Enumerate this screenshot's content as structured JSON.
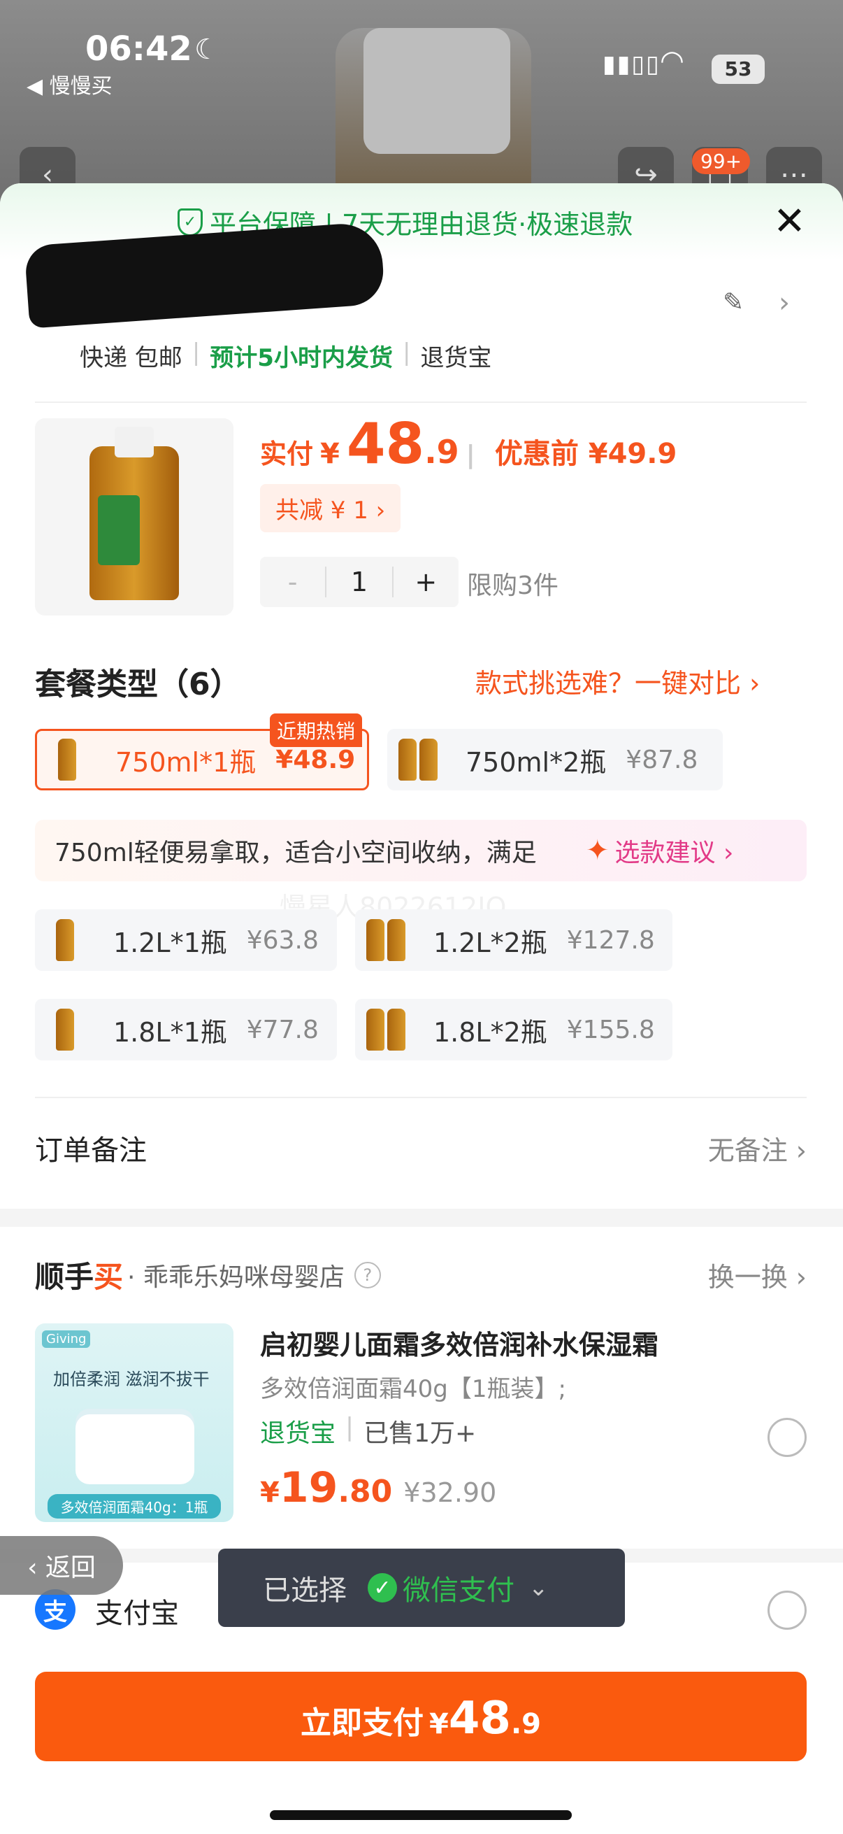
{
  "status_bar": {
    "time": "06:42",
    "back_app": "◀ 慢慢买",
    "battery": "53"
  },
  "background": {
    "cart_badge": "99+"
  },
  "guarantee": {
    "text": "平台保障 | 7天无理由退货·极速退款"
  },
  "shipping": {
    "method": "快递 包邮",
    "eta": "预计5小时内发货",
    "service": "退货宝"
  },
  "product": {
    "price_label": "实付",
    "currency": "¥",
    "price_int": "48",
    "price_dec": ".9",
    "price_before": "优惠前 ¥49.9",
    "discount": "共减 ¥ 1 ›",
    "qty": "1",
    "qty_minus": "-",
    "qty_plus": "+",
    "limit": "限购3件"
  },
  "package": {
    "title": "套餐类型（6）",
    "compare": "款式挑选难？一键对比 ›",
    "hot_tag": "近期热销",
    "options": [
      {
        "name": "750ml*1瓶",
        "price": "¥48.9"
      },
      {
        "name": "750ml*2瓶",
        "price": "¥87.8"
      },
      {
        "name": "1.2L*1瓶",
        "price": "¥63.8"
      },
      {
        "name": "1.2L*2瓶",
        "price": "¥127.8"
      },
      {
        "name": "1.8L*1瓶",
        "price": "¥77.8"
      },
      {
        "name": "1.8L*2瓶",
        "price": "¥155.8"
      }
    ],
    "suggest_text": "750ml轻便易拿取，适合小空间收纳，满足",
    "suggest_btn": "选款建议 ›",
    "watermark": "慢星人8022612JO"
  },
  "note": {
    "label": "订单备注",
    "value": "无备注 ›"
  },
  "shunshou": {
    "brand_a": "顺手",
    "brand_b": "买",
    "shop": "· 乖乖乐妈咪母婴店",
    "swap": "换一换 ›",
    "title": "启初婴儿面霜多效倍润补水保湿霜",
    "sku": "多效倍润面霜40g【1瓶装】;",
    "tag_a": "退货宝",
    "tag_b": "已售1万+",
    "price_sym": "¥",
    "price_int": "19",
    "price_dec": ".80",
    "price_orig": "¥32.90",
    "img_brand": "Giving",
    "img_slogan": "加倍柔润 滋润不拔干",
    "img_caption": "多效倍润面霜40g：1瓶"
  },
  "return_btn": "‹ 返回",
  "pay_select": {
    "label": "已选择",
    "method": "微信支付",
    "caret": "⌄"
  },
  "alipay": {
    "icon": "支",
    "label": "支付宝"
  },
  "pay_button": {
    "text": "立即支付",
    "sym": "¥",
    "int": "48",
    "dec": ".9"
  }
}
